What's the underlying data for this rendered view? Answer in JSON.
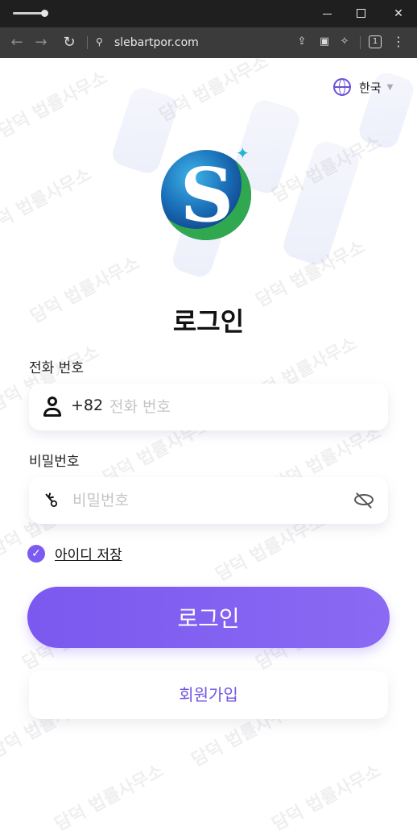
{
  "browser": {
    "url": "slebartpor.com",
    "tab_count": "1"
  },
  "language": {
    "label": "한국"
  },
  "watermark": "담덕 법률사무소",
  "login": {
    "title": "로그인",
    "phone_label": "전화 번호",
    "country_code": "+82",
    "phone_placeholder": "전화 번호",
    "password_label": "비밀번호",
    "password_placeholder": "비밀번호",
    "remember_label": "아이디 저장",
    "remember_checked": true,
    "submit_label": "로그인",
    "signup_label": "회원가입"
  },
  "colors": {
    "accent": "#7b58ef",
    "titlebar": "#1f1f1f",
    "toolbar": "#3b3b3b"
  }
}
